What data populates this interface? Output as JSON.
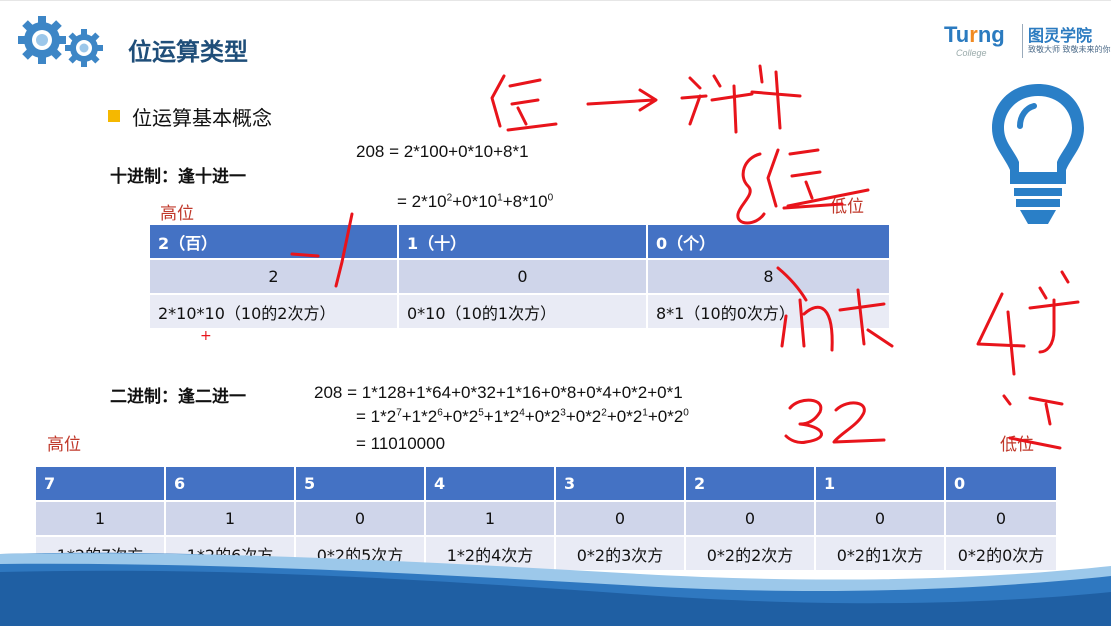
{
  "title": "位运算类型",
  "logo": {
    "word_a": "Tu",
    "word_b": "r",
    "word_c": "ng",
    "college": "College",
    "cn": "图灵学院",
    "slogan": "致敬大师 致敬未来的你"
  },
  "bullet": "位运算基本概念",
  "decimal": {
    "heading": "十进制：逢十进一",
    "eq1": "208 = 2*100+0*10+8*1",
    "eq2_prefix": "= 2*10",
    "eq2_e1": "2",
    "eq2_m1": "+0*10",
    "eq2_e2": "1",
    "eq2_m2": "+8*10",
    "eq2_e3": "0",
    "high": "高位",
    "low": "低位",
    "table": {
      "header": [
        "2（百）",
        "1（十）",
        "0（个）"
      ],
      "digits": [
        "2",
        "0",
        "8"
      ],
      "expr": [
        "2*10*10（10的2次方）",
        "0*10（10的1次方）",
        "8*1（10的0次方）"
      ]
    }
  },
  "binary": {
    "heading": "二进制：逢二进一",
    "eq1": "208 = 1*128+1*64+0*32+1*16+0*8+0*4+0*2+0*1",
    "eq2_parts": [
      "= 1*2",
      "7",
      "+1*2",
      "6",
      "+0*2",
      "5",
      "+1*2",
      "4",
      "+0*2",
      "3",
      "+0*2",
      "2",
      "+0*2",
      "1",
      "+0*2",
      "0"
    ],
    "eq3": "= 11010000",
    "high": "高位",
    "low": "低位",
    "table": {
      "header": [
        "7",
        "6",
        "5",
        "4",
        "3",
        "2",
        "1",
        "0"
      ],
      "digits": [
        "1",
        "1",
        "0",
        "1",
        "0",
        "0",
        "0",
        "0"
      ],
      "expr": [
        "1*2的7次方",
        "1*2的6次方",
        "0*2的5次方",
        "1*2的4次方",
        "0*2的3次方",
        "0*2的2次方",
        "0*2的1次方",
        "0*2的0次方"
      ]
    }
  },
  "annotation_marks": {
    "plus": "+"
  },
  "colors": {
    "header_blue": "#4472c4",
    "row1": "#cfd5ea",
    "row2": "#e9ebf5",
    "accent": "#f5b800",
    "ink": "#e8141b",
    "bulb": "#2a7fc7"
  },
  "icons": [
    "gears-icon",
    "lightbulb-icon"
  ]
}
